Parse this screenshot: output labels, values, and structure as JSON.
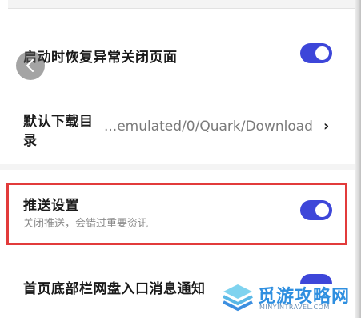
{
  "settings": {
    "restore": {
      "label": "启动时恢复异常关闭页面",
      "enabled": true
    },
    "download": {
      "label_line1": "默认下载目",
      "label_line2": "录",
      "value": "...emulated/0/Quark/Download"
    },
    "push": {
      "label": "推送设置",
      "subtitle": "关闭推送，会错过重要资讯",
      "enabled": true
    },
    "netdisk": {
      "label": "首页底部栏网盘入口消息通知",
      "enabled": true
    }
  },
  "watermark": {
    "text": "觅游攻略网",
    "url": "MINYINTRAVEL.COM"
  },
  "colors": {
    "accent": "#3d46d9",
    "highlight": "#e23b3b"
  }
}
